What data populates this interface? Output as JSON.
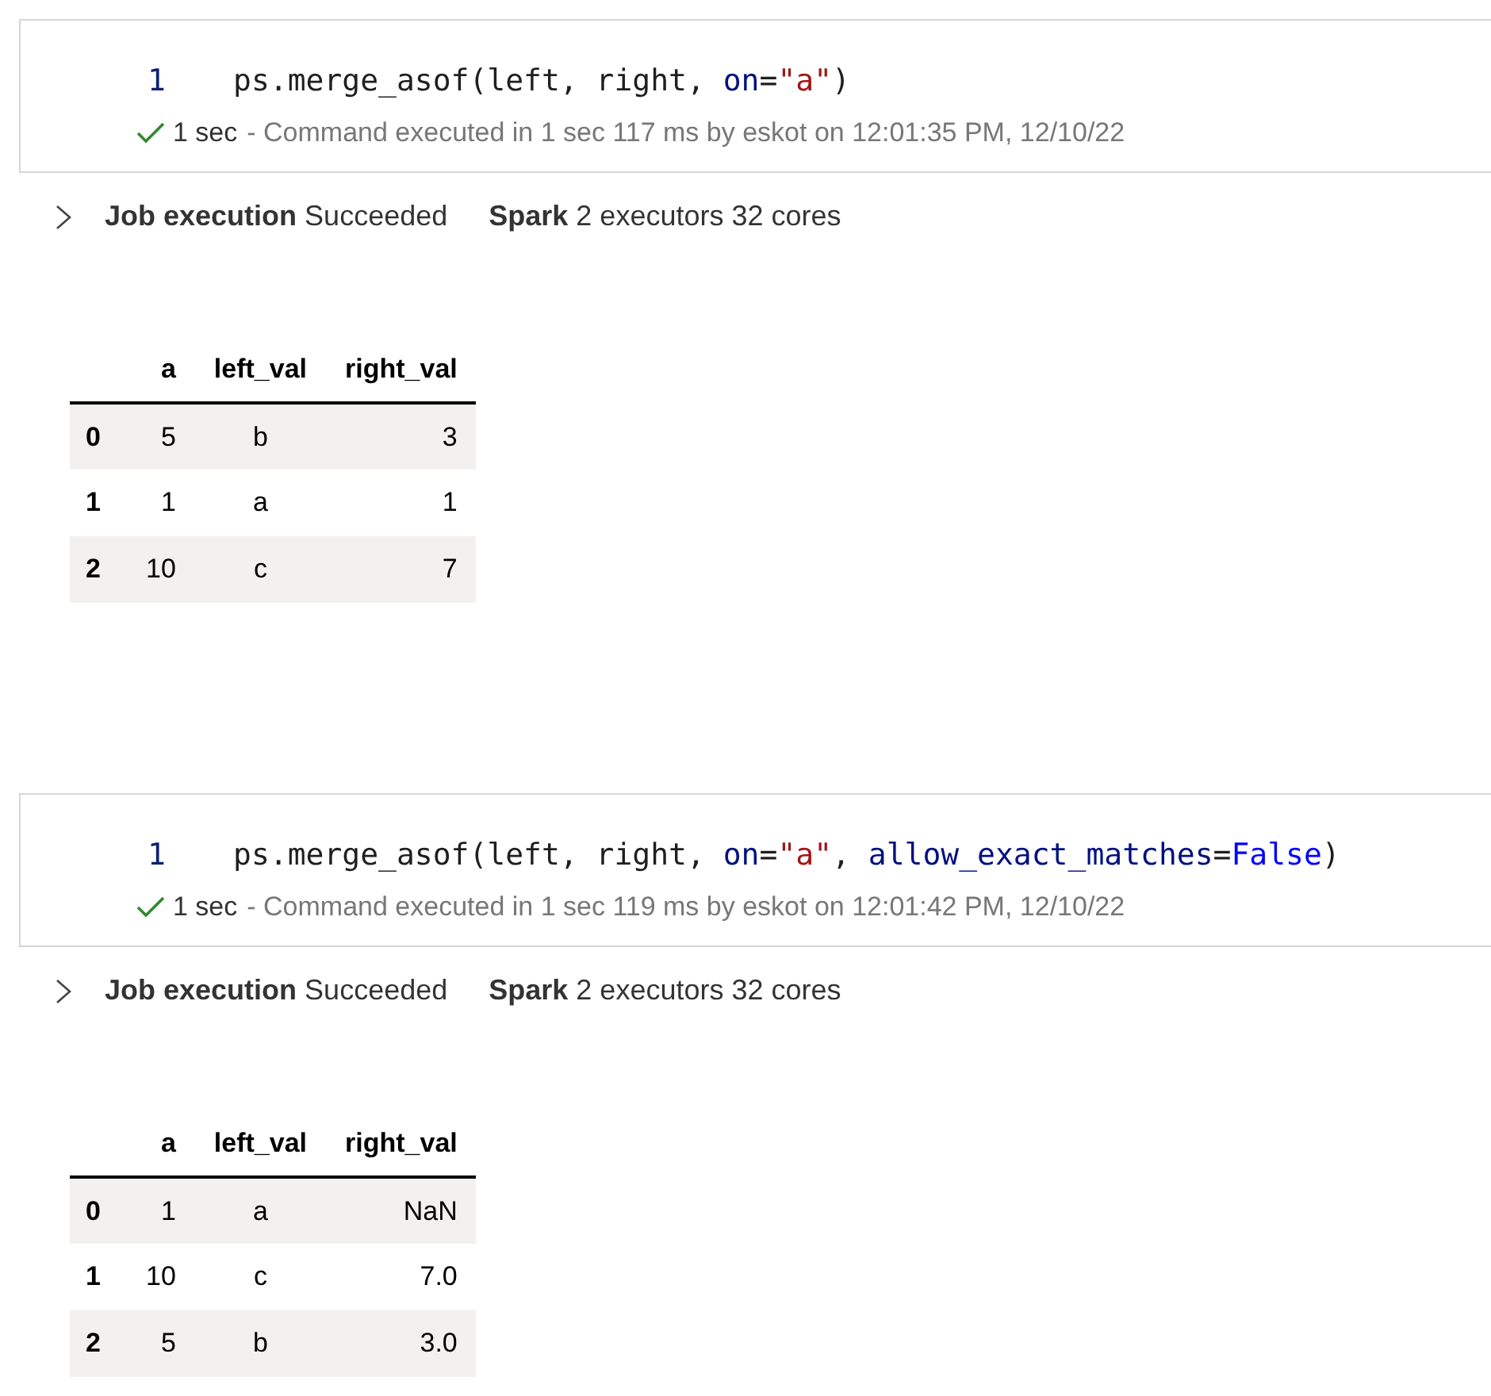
{
  "cells": [
    {
      "line_number": "1",
      "code": [
        {
          "kind": "plain",
          "text": "ps.merge_asof(left, right, "
        },
        {
          "kind": "param",
          "text": "on"
        },
        {
          "kind": "plain",
          "text": "="
        },
        {
          "kind": "string",
          "text": "\"a\""
        },
        {
          "kind": "plain",
          "text": ")"
        }
      ],
      "status": {
        "duration": "1 sec",
        "message": "- Command executed in 1 sec 117 ms by eskot on 12:01:35 PM, 12/10/22"
      },
      "job": {
        "label": "Job execution",
        "status": "Succeeded"
      },
      "spark": {
        "label": "Spark",
        "detail": "2 executors 32 cores"
      },
      "table": {
        "columns": [
          "a",
          "left_val",
          "right_val"
        ],
        "rows": [
          {
            "index": "0",
            "cells": [
              "5",
              "b",
              "3"
            ]
          },
          {
            "index": "1",
            "cells": [
              "1",
              "a",
              "1"
            ]
          },
          {
            "index": "2",
            "cells": [
              "10",
              "c",
              "7"
            ]
          }
        ]
      }
    },
    {
      "line_number": "1",
      "code": [
        {
          "kind": "plain",
          "text": "ps.merge_asof(left, right, "
        },
        {
          "kind": "param",
          "text": "on"
        },
        {
          "kind": "plain",
          "text": "="
        },
        {
          "kind": "string",
          "text": "\"a\""
        },
        {
          "kind": "plain",
          "text": ", "
        },
        {
          "kind": "param",
          "text": "allow_exact_matches"
        },
        {
          "kind": "plain",
          "text": "="
        },
        {
          "kind": "keyword",
          "text": "False"
        },
        {
          "kind": "plain",
          "text": ")"
        }
      ],
      "status": {
        "duration": "1 sec",
        "message": "- Command executed in 1 sec 119 ms by eskot on 12:01:42 PM, 12/10/22"
      },
      "job": {
        "label": "Job execution",
        "status": "Succeeded"
      },
      "spark": {
        "label": "Spark",
        "detail": "2 executors 32 cores"
      },
      "table": {
        "columns": [
          "a",
          "left_val",
          "right_val"
        ],
        "rows": [
          {
            "index": "0",
            "cells": [
              "1",
              "a",
              "NaN"
            ]
          },
          {
            "index": "1",
            "cells": [
              "10",
              "c",
              "7.0"
            ]
          },
          {
            "index": "2",
            "cells": [
              "5",
              "b",
              "3.0"
            ]
          }
        ]
      }
    }
  ]
}
